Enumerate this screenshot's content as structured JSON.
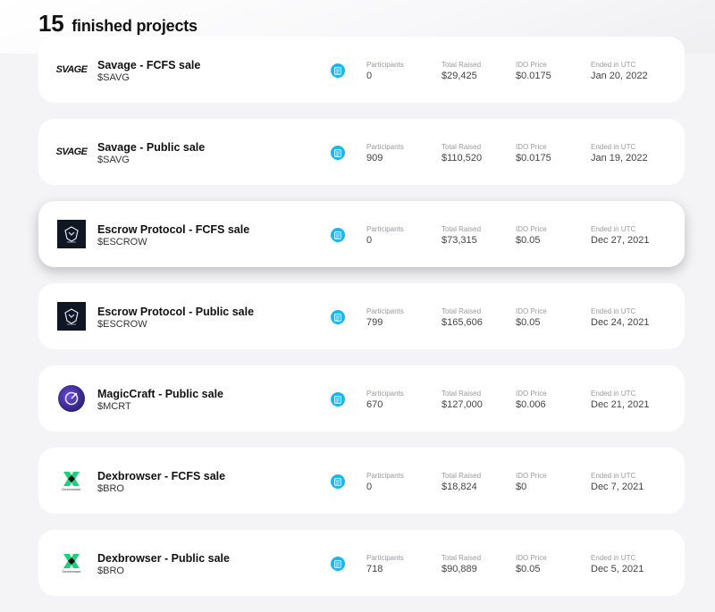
{
  "header": {
    "count": "15",
    "title": "finished projects"
  },
  "stat_labels": {
    "participants": "Participants",
    "total_raised": "Total Raised",
    "ido_price": "IDO Price",
    "ended": "Ended in UTC"
  },
  "logos": {
    "savage_text": "SVAGE",
    "dex_text": "Dexbrowser"
  },
  "colors": {
    "doc_icon": "#1bb5ef",
    "accent_green": "#1fcf7b"
  },
  "projects": [
    {
      "name": "Savage - FCFS sale",
      "ticker": "$SAVG",
      "participants": "0",
      "total_raised": "$29,425",
      "ido_price": "$0.0175",
      "ended": "Jan 20, 2022",
      "logo": "savage"
    },
    {
      "name": "Savage - Public sale",
      "ticker": "$SAVG",
      "participants": "909",
      "total_raised": "$110,520",
      "ido_price": "$0.0175",
      "ended": "Jan 19, 2022",
      "logo": "savage"
    },
    {
      "name": "Escrow Protocol - FCFS sale",
      "ticker": "$ESCROW",
      "participants": "0",
      "total_raised": "$73,315",
      "ido_price": "$0.05",
      "ended": "Dec 27, 2021",
      "logo": "escrow"
    },
    {
      "name": "Escrow Protocol - Public sale",
      "ticker": "$ESCROW",
      "participants": "799",
      "total_raised": "$165,606",
      "ido_price": "$0.05",
      "ended": "Dec 24, 2021",
      "logo": "escrow"
    },
    {
      "name": "MagicCraft - Public sale",
      "ticker": "$MCRT",
      "participants": "670",
      "total_raised": "$127,000",
      "ido_price": "$0.006",
      "ended": "Dec 21, 2021",
      "logo": "magiccraft"
    },
    {
      "name": "Dexbrowser - FCFS sale",
      "ticker": "$BRO",
      "participants": "0",
      "total_raised": "$18,824",
      "ido_price": "$0",
      "ended": "Dec 7, 2021",
      "logo": "dexbrowser"
    },
    {
      "name": "Dexbrowser - Public sale",
      "ticker": "$BRO",
      "participants": "718",
      "total_raised": "$90,889",
      "ido_price": "$0.05",
      "ended": "Dec 5, 2021",
      "logo": "dexbrowser"
    }
  ]
}
